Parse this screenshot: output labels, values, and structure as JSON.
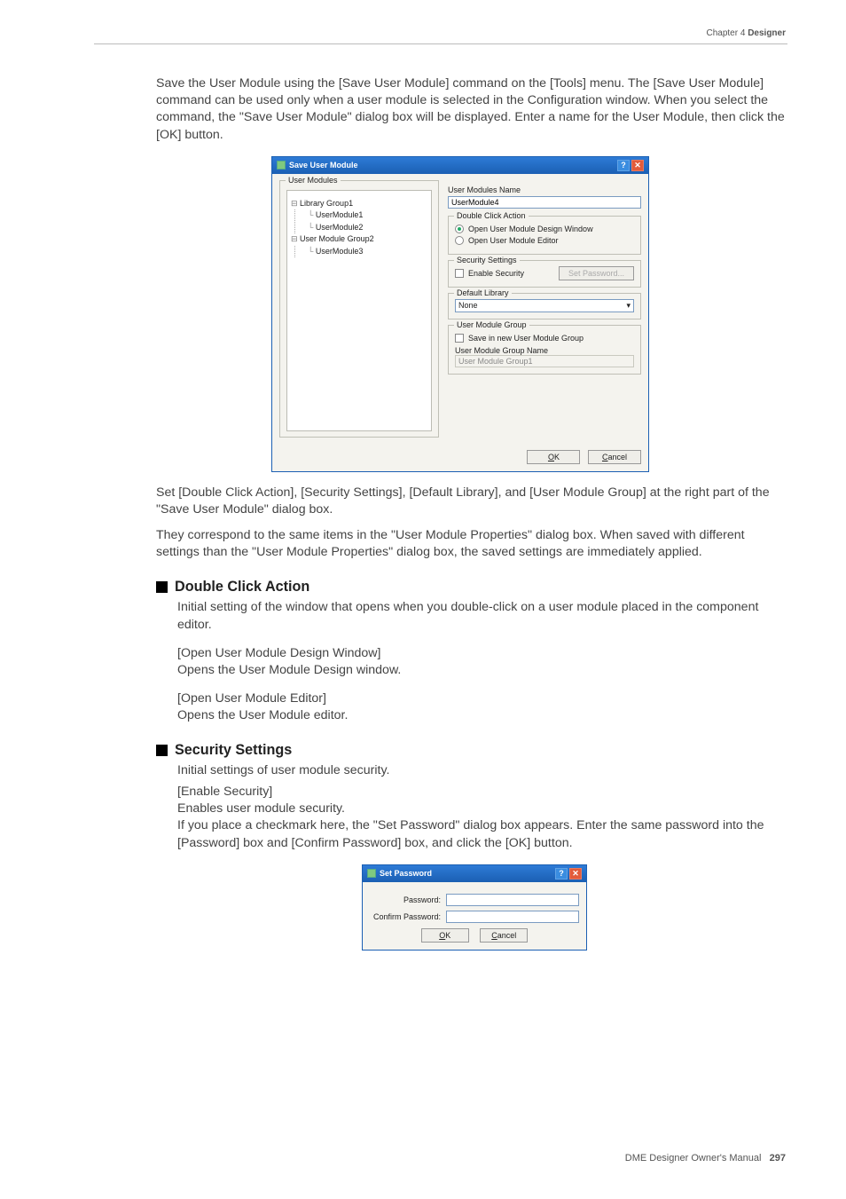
{
  "header": {
    "chapter": "Chapter 4  ",
    "section": "Designer"
  },
  "p1": "Save the User Module using the [Save User Module] command on the [Tools] menu. The [Save User Module] command can be used only when a user module is selected in the Configuration window. When you select the command, the \"Save User Module\" dialog box will be displayed. Enter a name for the User Module, then click the [OK] button.",
  "dlg1": {
    "title": "Save User Module",
    "userModules": {
      "legend": "User Modules",
      "tree": {
        "g1": "Library Group1",
        "g1c1": "UserModule1",
        "g1c2": "UserModule2",
        "g2": "User Module Group2",
        "g2c1": "UserModule3"
      }
    },
    "nameLabel": "User Modules Name",
    "nameValue": "UserModule4",
    "dca": {
      "legend": "Double Click Action",
      "r1": "Open User Module Design Window",
      "r2": "Open User Module Editor"
    },
    "sec": {
      "legend": "Security Settings",
      "chk": "Enable Security",
      "btn": "Set Password..."
    },
    "lib": {
      "legend": "Default Library",
      "val": "None"
    },
    "grp": {
      "legend": "User Module Group",
      "chk": "Save in new User Module Group",
      "nameLabel": "User Module Group Name",
      "nameValue": "User Module Group1"
    },
    "ok": "OK",
    "cancel": "Cancel"
  },
  "p2": "Set [Double Click Action], [Security Settings], [Default Library], and [User Module Group] at the right part of the \"Save User Module\" dialog box.",
  "p3": "They correspond to the same items in the \"User Module Properties\" dialog box. When saved with different settings than the \"User Module Properties\" dialog box, the saved settings are immediately applied.",
  "sDca": {
    "title": "Double Click Action",
    "desc": "Initial setting of the window that opens when you double-click on a user module placed in the component editor.",
    "sub1h": "[Open User Module Design Window]",
    "sub1t": "Opens the User Module Design window.",
    "sub2h": "[Open User Module Editor]",
    "sub2t": "Opens the User Module editor."
  },
  "sSec": {
    "title": "Security Settings",
    "desc": "Initial settings of user module security.",
    "sub1h": "[Enable Security]",
    "sub1t1": "Enables user module security.",
    "sub1t2": "If you place a checkmark here, the \"Set Password\" dialog box appears. Enter the same password into the [Password] box and [Confirm Password] box, and click the [OK] button."
  },
  "dlg2": {
    "title": "Set Password",
    "l1": "Password:",
    "l2": "Confirm Password:",
    "ok": "OK",
    "cancel": "Cancel"
  },
  "footer": {
    "manual": "DME Designer Owner's Manual",
    "page": "297"
  }
}
